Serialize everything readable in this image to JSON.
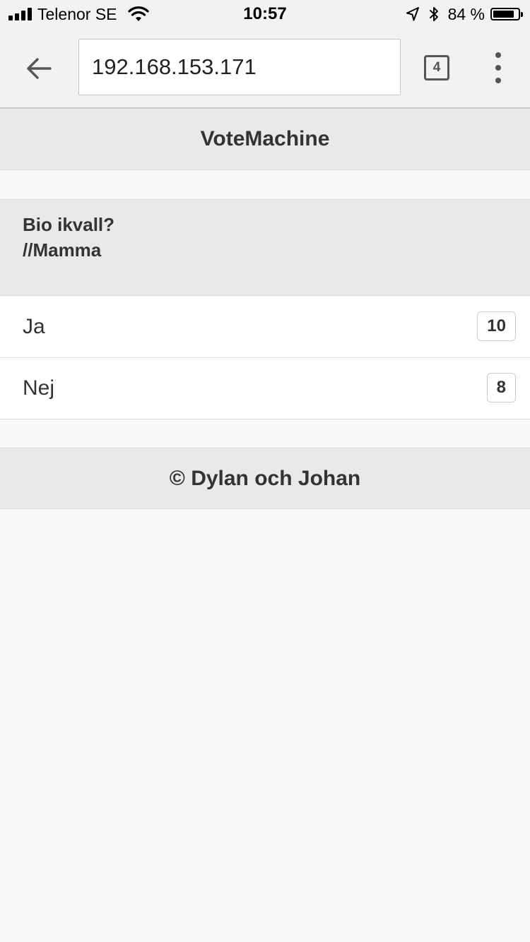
{
  "status_bar": {
    "carrier": "Telenor SE",
    "time": "10:57",
    "battery_percent": "84 %",
    "battery_level": 0.84
  },
  "browser": {
    "url": "192.168.153.171",
    "tab_count": "4"
  },
  "app": {
    "title": "VoteMachine"
  },
  "poll": {
    "question": "Bio ikvall?",
    "author": "//Mamma",
    "options": [
      {
        "label": "Ja",
        "votes": "10"
      },
      {
        "label": "Nej",
        "votes": "8"
      }
    ]
  },
  "footer": {
    "text": "© Dylan och Johan"
  }
}
